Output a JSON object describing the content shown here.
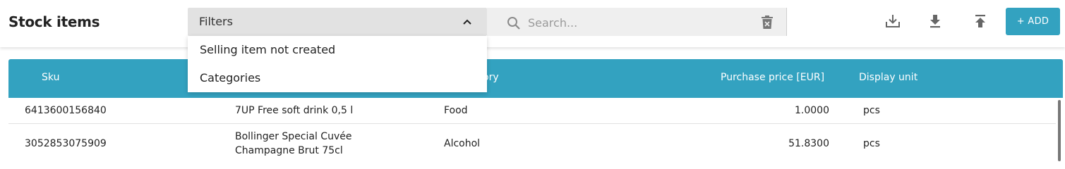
{
  "page": {
    "title": "Stock items"
  },
  "filters": {
    "label": "Filters",
    "expanded": true,
    "options": [
      "Selling item not created",
      "Categories"
    ]
  },
  "search": {
    "placeholder": "Search...",
    "value": ""
  },
  "toolbar": {
    "download_icon": "tray-download-icon",
    "export_icon": "download-arrow-icon",
    "upload_icon": "upload-arrow-icon",
    "add_label": "+ ADD"
  },
  "table": {
    "columns": [
      "Sku",
      "",
      "ory",
      "Purchase price [EUR]",
      "Display unit"
    ],
    "rows": [
      {
        "sku": "6413600156840",
        "name": "7UP Free soft drink 0,5 l",
        "name2": "",
        "category": "Food",
        "price": "1.0000",
        "unit": "pcs"
      },
      {
        "sku": "3052853075909",
        "name": "Bollinger Special Cuvée",
        "name2": "Champagne Brut 75cl",
        "category": "Alcohol",
        "price": "51.8300",
        "unit": "pcs"
      }
    ]
  },
  "colors": {
    "accent": "#33a2c0",
    "filters_bg": "#e2e2e2",
    "search_bg": "#efefef"
  }
}
